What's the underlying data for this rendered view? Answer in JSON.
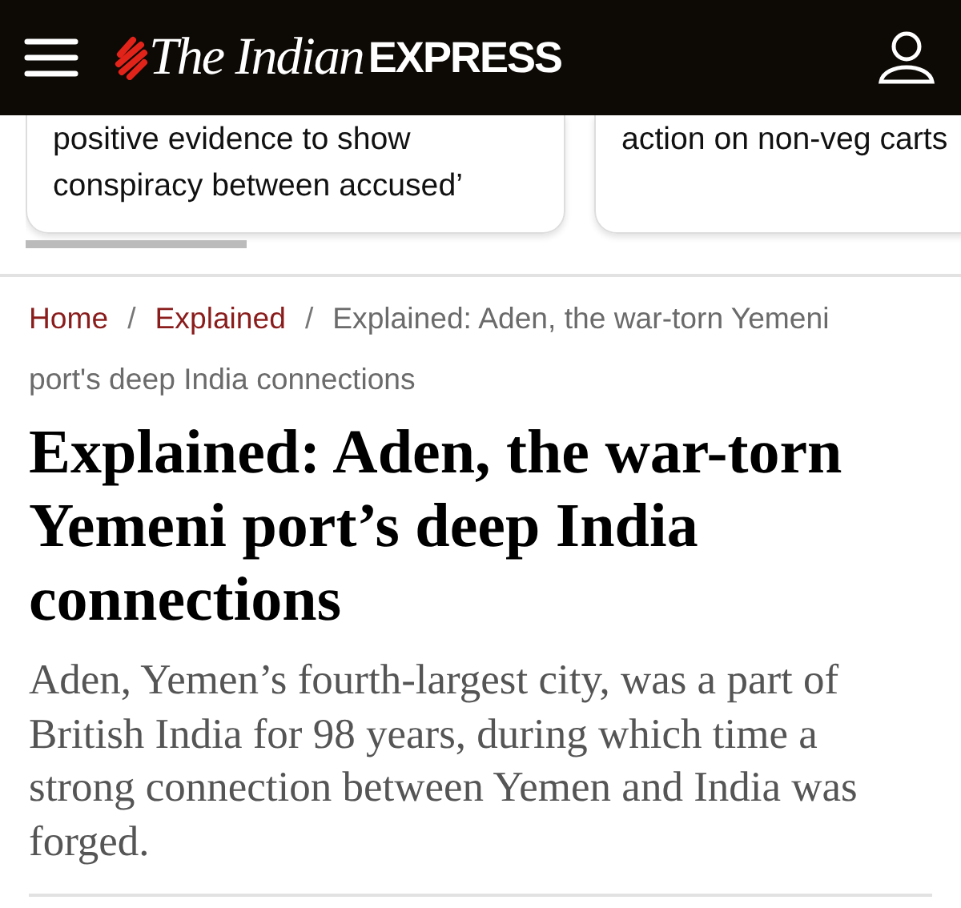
{
  "header": {
    "logo_main": "The Indian",
    "logo_bold": "EXPRESS"
  },
  "cards": [
    {
      "lines": [
        "positive evidence to show",
        "conspiracy between accused’"
      ]
    },
    {
      "lines": [
        "action on non-veg carts"
      ]
    }
  ],
  "breadcrumb": [
    {
      "kind": "link",
      "label": "Home"
    },
    {
      "kind": "separator",
      "label": "/"
    },
    {
      "kind": "link",
      "label": "Explained"
    },
    {
      "kind": "separator",
      "label": "/"
    },
    {
      "kind": "current",
      "lines": [
        "Explained: Aden, the war-torn Yemeni",
        "port's deep India connections"
      ]
    }
  ],
  "article": {
    "headline": "Explained: Aden, the war-torn Yemeni port’s deep India connections",
    "summary": "Aden, Yemen’s fourth-largest city, was a part of British India for 98 years, during which time a strong connection between Yemen and India was forged."
  }
}
